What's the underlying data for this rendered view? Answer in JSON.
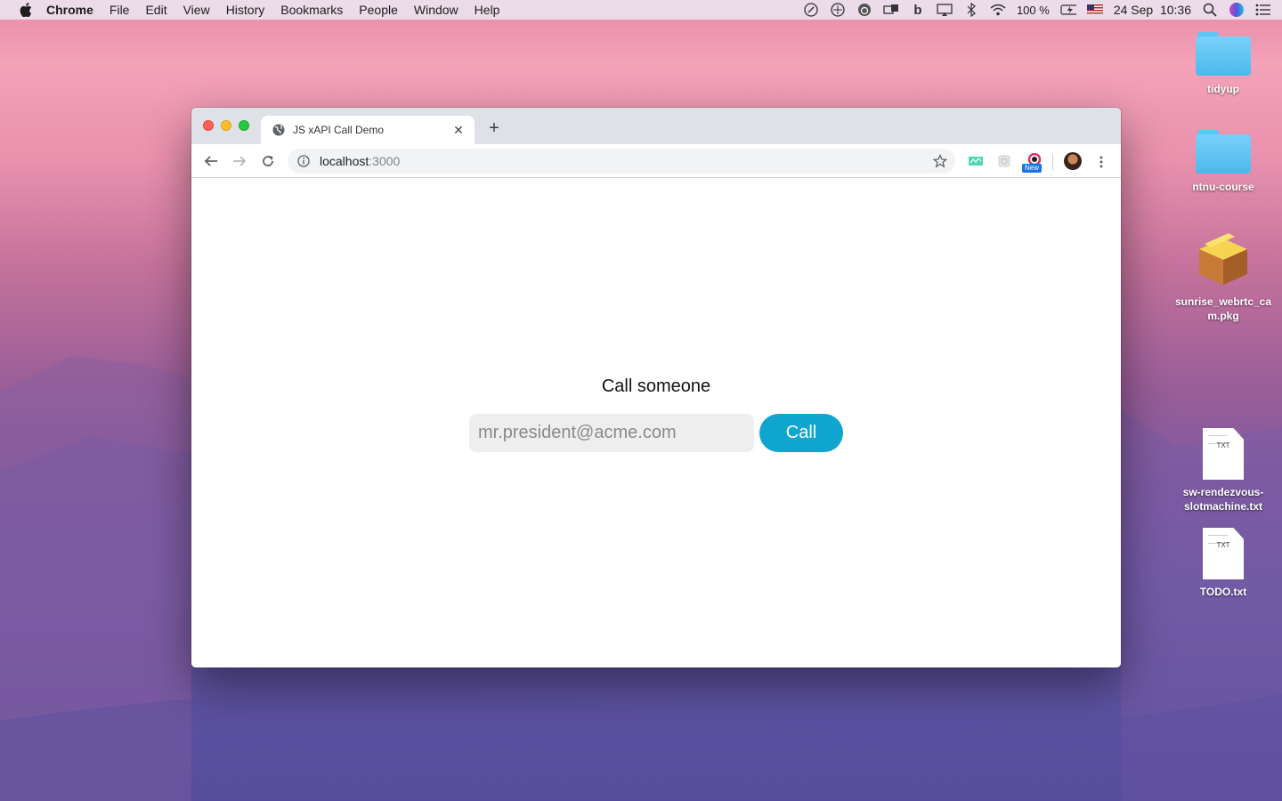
{
  "menubar": {
    "app_name": "Chrome",
    "items": [
      "File",
      "Edit",
      "View",
      "History",
      "Bookmarks",
      "People",
      "Window",
      "Help"
    ],
    "battery": "100 %",
    "datetime": "24 Sep  10:36"
  },
  "desktop": {
    "items": [
      {
        "label": "tidyup",
        "type": "folder"
      },
      {
        "label": "ntnu-course",
        "type": "folder"
      },
      {
        "label": "sunrise_webrtc_cam.pkg",
        "type": "package"
      },
      {
        "label": "sw-rendezvous-slotmachine.txt",
        "type": "text",
        "ext": "TXT"
      },
      {
        "label": "TODO.txt",
        "type": "text",
        "ext": "TXT"
      }
    ]
  },
  "browser": {
    "tab_title": "JS xAPI Call Demo",
    "url_host": "localhost",
    "url_port": ":3000",
    "extension_badge": "New"
  },
  "page": {
    "heading": "Call someone",
    "input_placeholder": "mr.president@acme.com",
    "call_button": "Call"
  },
  "colors": {
    "call_button": "#0fa5cf",
    "input_bg": "#eeeeee"
  }
}
